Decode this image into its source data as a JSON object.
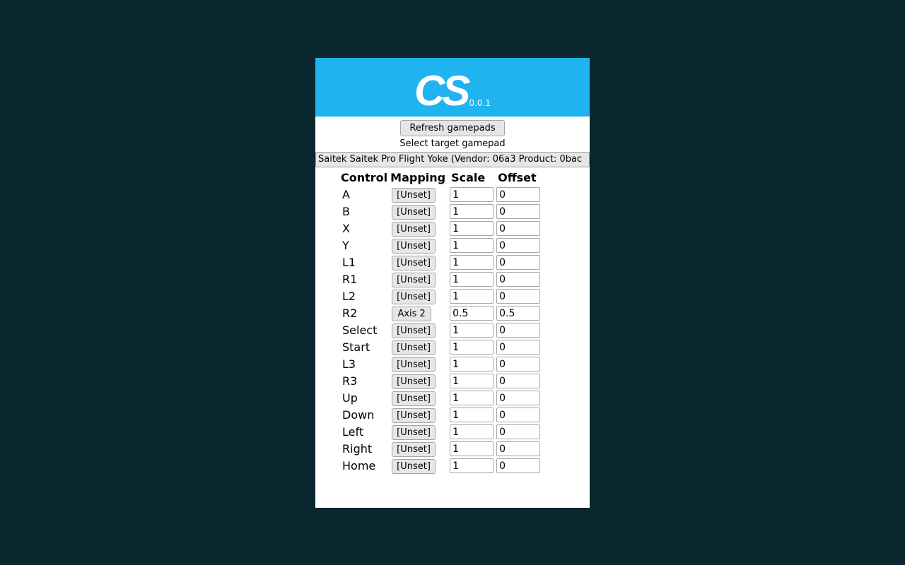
{
  "banner": {
    "logo_text": "CS",
    "version": "0.0.1"
  },
  "toolbar": {
    "refresh_label": "Refresh gamepads",
    "select_hint": "Select target gamepad",
    "device_selected": "Saitek Saitek Pro Flight Yoke (Vendor: 06a3 Product: 0bac"
  },
  "table": {
    "headers": {
      "control": "Control",
      "mapping": "Mapping",
      "scale": "Scale",
      "offset": "Offset"
    },
    "rows": [
      {
        "control": "A",
        "mapping": "[Unset]",
        "scale": "1",
        "offset": "0"
      },
      {
        "control": "B",
        "mapping": "[Unset]",
        "scale": "1",
        "offset": "0"
      },
      {
        "control": "X",
        "mapping": "[Unset]",
        "scale": "1",
        "offset": "0"
      },
      {
        "control": "Y",
        "mapping": "[Unset]",
        "scale": "1",
        "offset": "0"
      },
      {
        "control": "L1",
        "mapping": "[Unset]",
        "scale": "1",
        "offset": "0"
      },
      {
        "control": "R1",
        "mapping": "[Unset]",
        "scale": "1",
        "offset": "0"
      },
      {
        "control": "L2",
        "mapping": "[Unset]",
        "scale": "1",
        "offset": "0"
      },
      {
        "control": "R2",
        "mapping": "Axis 2",
        "scale": "0.5",
        "offset": "0.5"
      },
      {
        "control": "Select",
        "mapping": "[Unset]",
        "scale": "1",
        "offset": "0"
      },
      {
        "control": "Start",
        "mapping": "[Unset]",
        "scale": "1",
        "offset": "0"
      },
      {
        "control": "L3",
        "mapping": "[Unset]",
        "scale": "1",
        "offset": "0"
      },
      {
        "control": "R3",
        "mapping": "[Unset]",
        "scale": "1",
        "offset": "0"
      },
      {
        "control": "Up",
        "mapping": "[Unset]",
        "scale": "1",
        "offset": "0"
      },
      {
        "control": "Down",
        "mapping": "[Unset]",
        "scale": "1",
        "offset": "0"
      },
      {
        "control": "Left",
        "mapping": "[Unset]",
        "scale": "1",
        "offset": "0"
      },
      {
        "control": "Right",
        "mapping": "[Unset]",
        "scale": "1",
        "offset": "0"
      },
      {
        "control": "Home",
        "mapping": "[Unset]",
        "scale": "1",
        "offset": "0"
      }
    ]
  }
}
